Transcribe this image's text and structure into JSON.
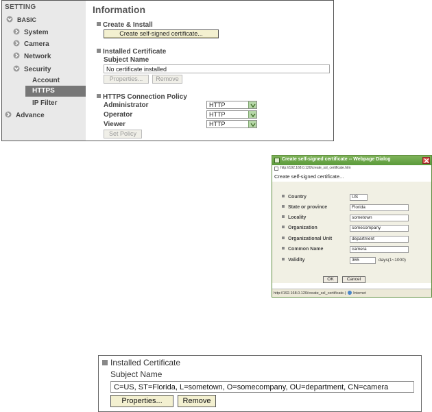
{
  "sidebar": {
    "setting": "SETTING",
    "basic": "BASIC",
    "items": [
      {
        "label": "System"
      },
      {
        "label": "Camera"
      },
      {
        "label": "Network"
      },
      {
        "label": "Security"
      }
    ],
    "sub_items": [
      {
        "label": "Account"
      },
      {
        "label": "HTTPS"
      },
      {
        "label": "IP Filter"
      }
    ],
    "advance": "Advance"
  },
  "info": {
    "title": "Information",
    "create_install": "Create & Install",
    "create_button": "Create self-signed certificate...",
    "installed_certificate": "Installed Certificate",
    "subject_name": "Subject Name",
    "subject_value": "No certificate installed",
    "properties_button": "Properties...",
    "remove_button": "Remove",
    "policy_heading": "HTTPS Connection Policy",
    "policy_rows": [
      {
        "label": "Administrator",
        "value": "HTTP"
      },
      {
        "label": "Operator",
        "value": "HTTP"
      },
      {
        "label": "Viewer",
        "value": "HTTP"
      }
    ],
    "set_policy_button": "Set Policy"
  },
  "dialog": {
    "title": "Create self-signed certificate -- Webpage Dialog",
    "url": "http://192.168.0.120/create_ssl_certificate.htm",
    "heading": "Create self-signed certificate...",
    "fields": [
      {
        "label": "Country",
        "value": "US"
      },
      {
        "label": "State or province",
        "value": "Florida"
      },
      {
        "label": "Locality",
        "value": "sometown"
      },
      {
        "label": "Organization",
        "value": "somecompany"
      },
      {
        "label": "Organizational Unit",
        "value": "department"
      },
      {
        "label": "Common Name",
        "value": "camera"
      },
      {
        "label": "Validity",
        "value": "365"
      }
    ],
    "validity_unit": "days(1~1000)",
    "ok_button": "OK",
    "cancel_button": "Cancel",
    "status_url": "http://192.168.0.120/create_ssl_certificate.|",
    "status_zone": "Internet"
  },
  "zoom": {
    "installed_certificate": "Installed Certificate",
    "subject_name": "Subject Name",
    "subject_value": "C=US, ST=Florida, L=sometown, O=somecompany, OU=department, CN=camera",
    "properties_button": "Properties...",
    "remove_button": "Remove"
  },
  "colors": {
    "dialog_title_bar": "#6aa646",
    "dropdown_green": "#b6d7a8",
    "button_yellow": "#f3f0d0",
    "sidebar_selected": "#777777"
  }
}
